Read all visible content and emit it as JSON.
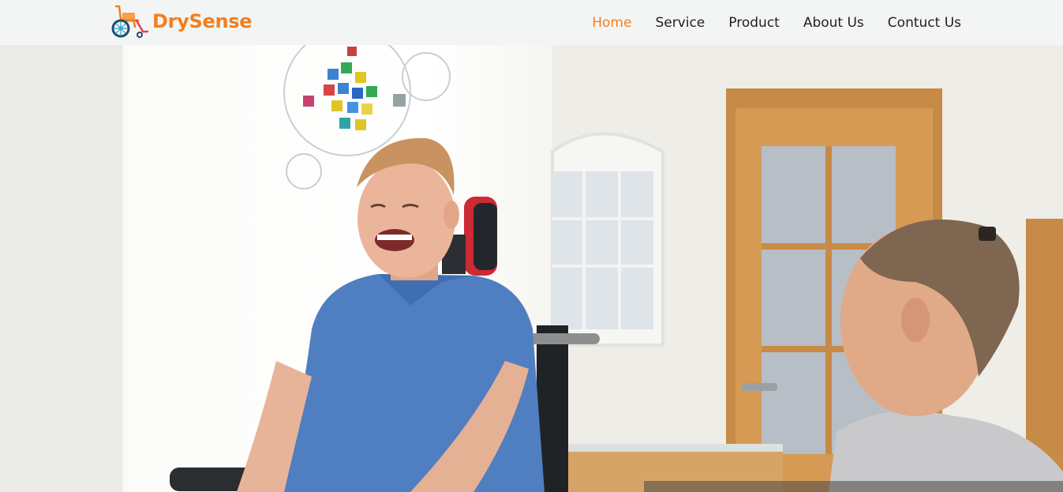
{
  "brand": {
    "name": "DrySense",
    "logo_icon": "wheelchair-icon",
    "color": "#f47e1e"
  },
  "nav": {
    "items": [
      {
        "label": "Home",
        "active": true
      },
      {
        "label": "Service",
        "active": false
      },
      {
        "label": "Product",
        "active": false
      },
      {
        "label": "About Us",
        "active": false
      },
      {
        "label": "Contuct Us",
        "active": false
      }
    ],
    "active_color": "#f47e1e"
  },
  "hero": {
    "image": "smiling-man-in-wheelchair-with-woman-photo"
  }
}
